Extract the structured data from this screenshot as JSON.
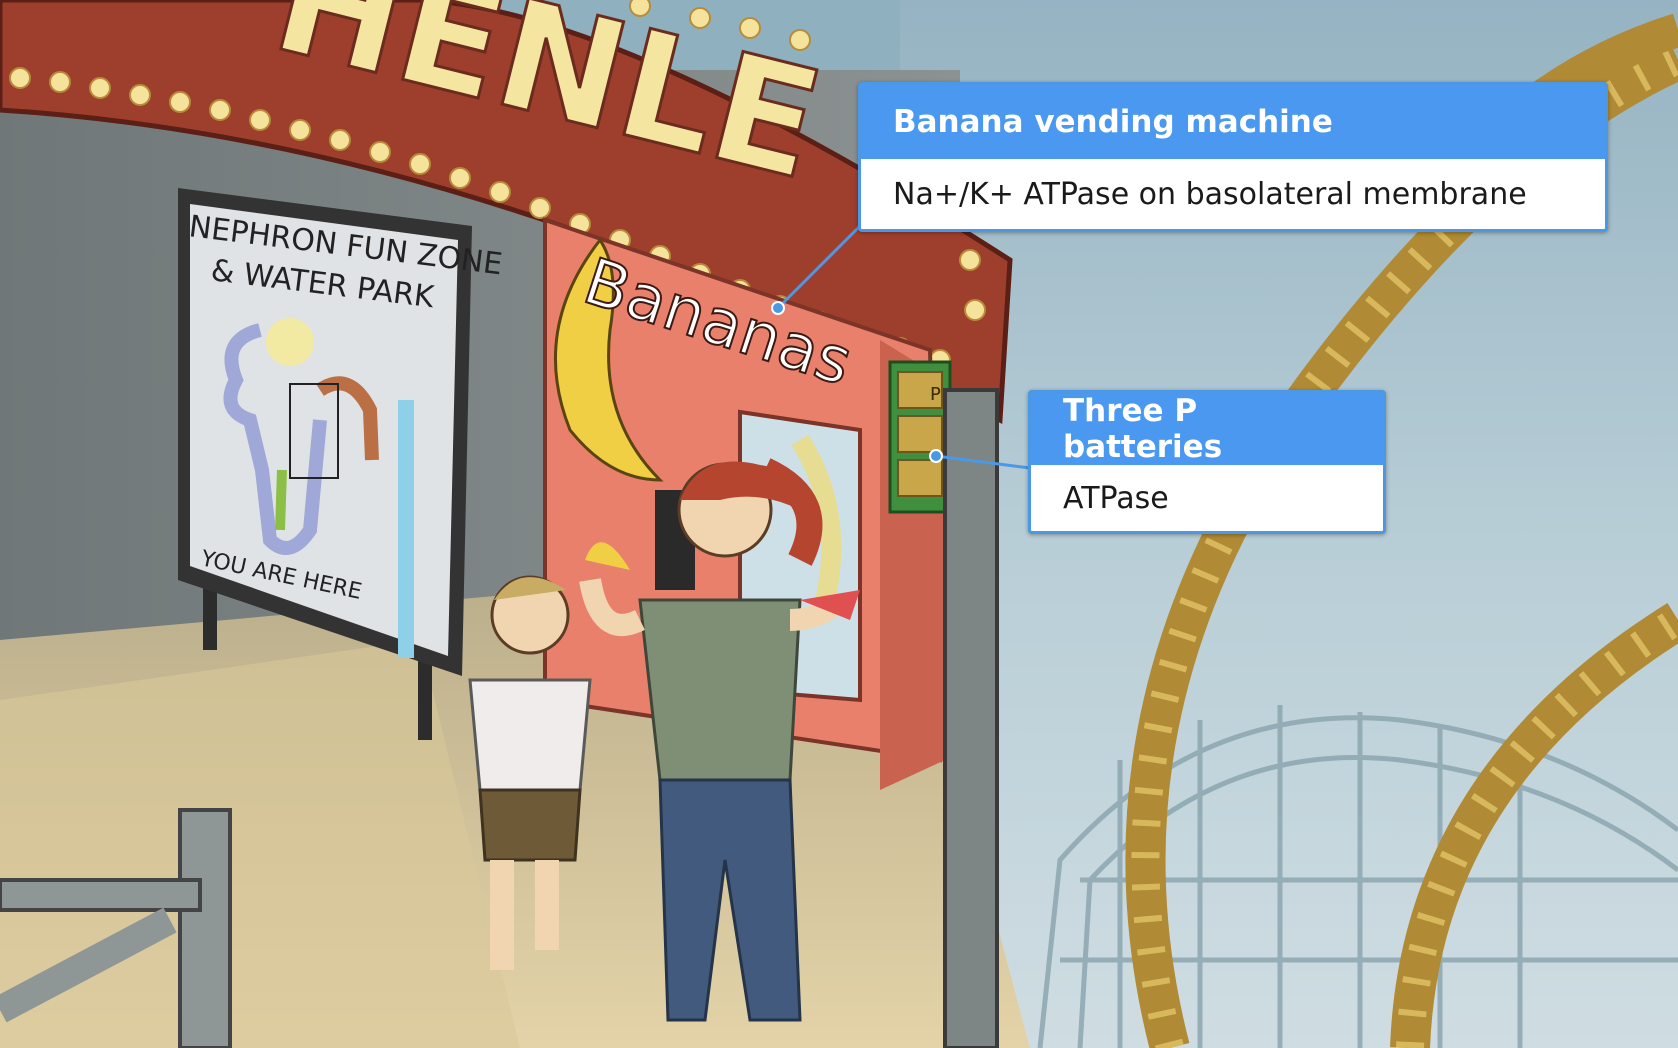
{
  "scene": {
    "marquee_text": "HENLE",
    "billboard_title_line1": "NEPHRON FUN ZONE",
    "billboard_title_line2": "& WATER PARK",
    "billboard_footer": "YOU ARE HERE",
    "machine_sign": "Bananas",
    "battery_label": "P"
  },
  "callouts": [
    {
      "title": "Banana vending machine",
      "body": "Na+/K+ ATPase on basolateral membrane"
    },
    {
      "title": "Three P batteries",
      "body": "ATPase"
    }
  ],
  "colors": {
    "callout_header": "#4a98ef",
    "callout_border": "#4a98e6",
    "marquee_red": "#9e3f2e",
    "marquee_text": "#f4e6a0",
    "machine_body": "#e9806c",
    "sky": "#a9c3cf",
    "track_gold": "#c7a34a"
  }
}
